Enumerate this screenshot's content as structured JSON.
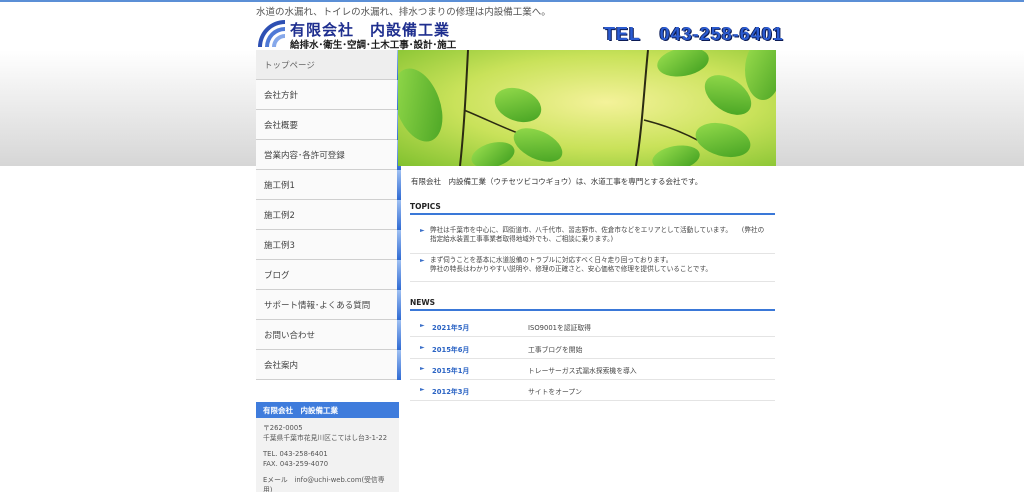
{
  "header": {
    "tagline": "水道の水漏れ、トイレの水漏れ、排水つまりの修理は内設備工業へ。",
    "company_name": "有限会社　内設備工業",
    "company_sub": "給排水･衛生･空調･土木工事･設計･施工",
    "tel": "TEL　043-258-6401"
  },
  "nav": {
    "items": [
      {
        "label": "トップページ"
      },
      {
        "label": "会社方針"
      },
      {
        "label": "会社概要"
      },
      {
        "label": "営業内容･各許可登録"
      },
      {
        "label": "施工例1"
      },
      {
        "label": "施工例2"
      },
      {
        "label": "施工例3"
      },
      {
        "label": "ブログ"
      },
      {
        "label": "サポート情報･よくある質問"
      },
      {
        "label": "お問い合わせ"
      },
      {
        "label": "会社案内"
      }
    ]
  },
  "company_box": {
    "title": "有限会社　内設備工業",
    "postal": "〒262-0005",
    "address": "千葉県千葉市花見川区こてはし台3-1-22",
    "tel": "TEL. 043-258-6401",
    "fax": "FAX. 043-259-4070",
    "email": "Eメール　info@uchi-web.com(受信専用)"
  },
  "main": {
    "intro": "有限会社　内設備工業（ウチセツビコウギョウ）は、水道工事を専門とする会社です。",
    "topics_heading": "TOPICS",
    "topics": [
      {
        "line1": "弊社は千葉市を中心に、四街道市、八千代市、習志野市、佐倉市などをエリアとして活動しています。　　(弊社の",
        "line2": "指定給水装置工事事業者取得地域外でも、ご相談に乗ります。)"
      },
      {
        "line1": "まず伺うことを基本に水道設備のトラブルに対応すべく日々走り回っております。",
        "line2": "弊社の特長はわかりやすい説明や、修理の正確さと、安心価格で修理を提供していることです。"
      }
    ],
    "news_heading": "NEWS",
    "news": [
      {
        "date": "2021年5月",
        "title": "ISO9001を認証取得"
      },
      {
        "date": "2015年6月",
        "title": "工事ブログを開始"
      },
      {
        "date": "2015年1月",
        "title": "トレーサーガス式漏水探索機を導入"
      },
      {
        "date": "2012年3月",
        "title": "サイトをオープン"
      }
    ]
  },
  "colors": {
    "accent_blue": "#3a78d8",
    "tel_blue": "#2b5bd0",
    "logo_navy": "#1f2f8f"
  }
}
